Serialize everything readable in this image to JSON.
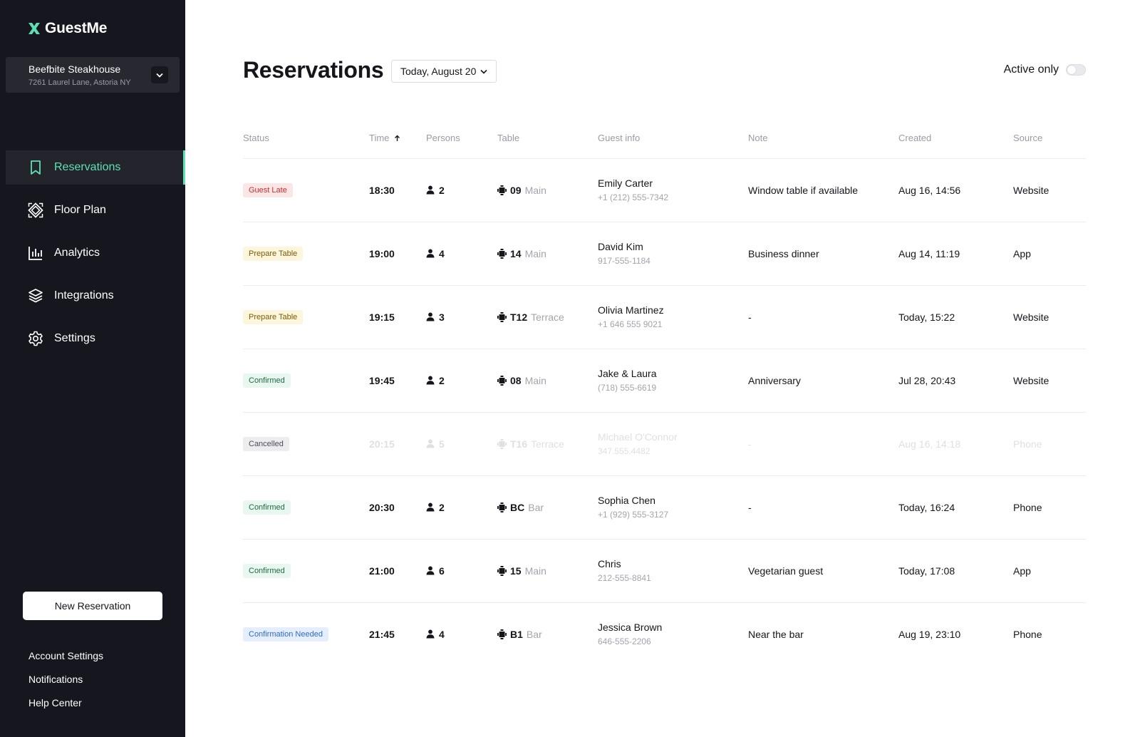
{
  "app": {
    "name": "GuestMe",
    "brand_color": "#5ce0b5",
    "sidebar_bg": "#16171e"
  },
  "venue": {
    "name": "Beefbite Steakhouse",
    "address": "7261 Laurel Lane, Astoria NY",
    "toggle_icon": "chevron-down-icon"
  },
  "nav": [
    {
      "label": "Reservations",
      "icon": "bookmark-icon",
      "active": true
    },
    {
      "label": "Floor Plan",
      "icon": "floor-plan-icon",
      "active": false
    },
    {
      "label": "Analytics",
      "icon": "bar-chart-icon",
      "active": false
    },
    {
      "label": "Integrations",
      "icon": "layers-icon",
      "active": false
    },
    {
      "label": "Settings",
      "icon": "gear-icon",
      "active": false
    }
  ],
  "new_reservation_label": "New Reservation",
  "footer_links": [
    "Account Settings",
    "Notifications",
    "Help Center"
  ],
  "page": {
    "title": "Reservations",
    "date_filter": "Today, August 20",
    "active_only_label": "Active only",
    "active_only_on": false
  },
  "columns": [
    "Status",
    "Time",
    "Persons",
    "Table",
    "Guest info",
    "Note",
    "Created",
    "Source"
  ],
  "sort": {
    "column": "Time",
    "direction": "ascending"
  },
  "reservations": [
    {
      "status": "Guest Late",
      "time": "18:30",
      "persons": "2",
      "table": "09",
      "area": "Main",
      "guest": "Emily Carter",
      "phone": "+1 (212) 555-7342",
      "note": "Window table if available",
      "created": "Aug 16, 14:56",
      "source": "Website"
    },
    {
      "status": "Prepare Table",
      "time": "19:00",
      "persons": "4",
      "table": "14",
      "area": "Main",
      "guest": "David Kim",
      "phone": "917-555-1184",
      "note": "Business dinner",
      "created": "Aug 14, 11:19",
      "source": "App"
    },
    {
      "status": "Prepare Table",
      "time": "19:15",
      "persons": "3",
      "table": "T12",
      "area": "Terrace",
      "guest": "Olivia Martinez",
      "phone": "+1 646 555 9021",
      "note": "-",
      "created": "Today, 15:22",
      "source": "Website"
    },
    {
      "status": "Confirmed",
      "time": "19:45",
      "persons": "2",
      "table": "08",
      "area": "Main",
      "guest": "Jake & Laura",
      "phone": "(718) 555-6619",
      "note": "Anniversary",
      "created": "Jul 28, 20:43",
      "source": "Website"
    },
    {
      "status": "Cancelled",
      "time": "20:15",
      "persons": "5",
      "table": "T16",
      "area": "Terrace",
      "guest": "Michael O'Connor",
      "phone": "347.555.4482",
      "note": "-",
      "created": "Aug 16, 14:18",
      "source": "Phone"
    },
    {
      "status": "Confirmed",
      "time": "20:30",
      "persons": "2",
      "table": "BC",
      "area": "Bar",
      "guest": "Sophia Chen",
      "phone": "+1 (929) 555-3127",
      "note": "-",
      "created": "Today, 16:24",
      "source": "Phone"
    },
    {
      "status": "Confirmed",
      "time": "21:00",
      "persons": "6",
      "table": "15",
      "area": "Main",
      "guest": "Chris",
      "phone": "212-555-8841",
      "note": "Vegetarian guest",
      "created": "Today, 17:08",
      "source": "App"
    },
    {
      "status": "Confirmation Needed",
      "time": "21:45",
      "persons": "4",
      "table": "B1",
      "area": "Bar",
      "guest": "Jessica Brown",
      "phone": "646-555-2206",
      "note": "Near the bar",
      "created": "Aug 19, 23:10",
      "source": "Phone"
    }
  ],
  "status_colors": {
    "Guest Late": {
      "bg": "#fbe6e6",
      "fg": "#c62f2f"
    },
    "Prepare Table": {
      "bg": "#fcf6dd",
      "fg": "#7b5b0b"
    },
    "Confirmed": {
      "bg": "#e8f7ef",
      "fg": "#1f6a44"
    },
    "Cancelled": {
      "bg": "#ededef",
      "fg": "#4b4c53"
    },
    "Confirmation Needed": {
      "bg": "#e4eefc",
      "fg": "#2f6bcf"
    }
  }
}
